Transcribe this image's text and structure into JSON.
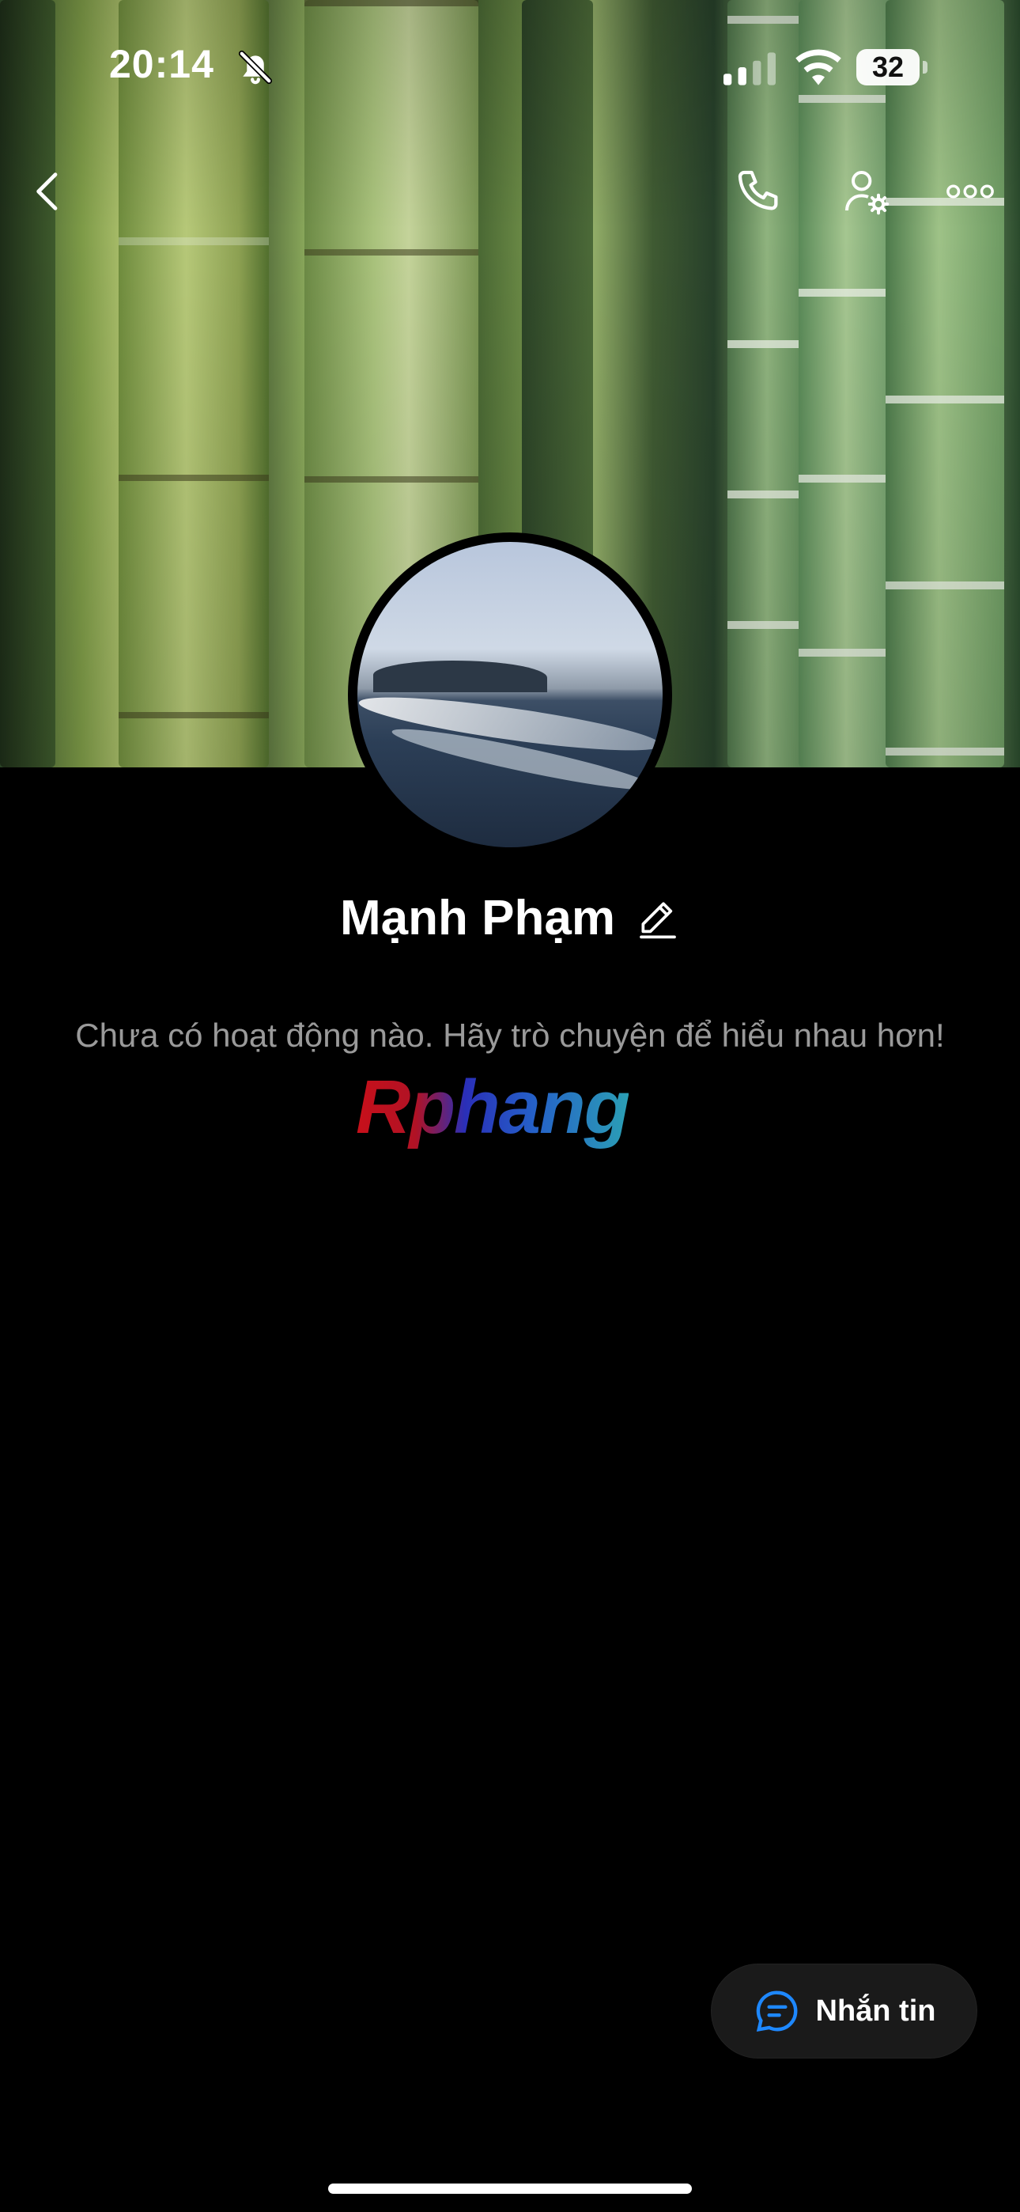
{
  "status_bar": {
    "time": "20:14",
    "battery_level": "32",
    "icons": [
      "bell-slash-icon",
      "cellular-signal-icon",
      "wifi-icon",
      "battery-icon"
    ]
  },
  "nav": {
    "icons": [
      "chevron-left-icon",
      "phone-icon",
      "user-settings-icon",
      "more-icon"
    ]
  },
  "profile": {
    "name": "Mạnh Phạm",
    "empty_message": "Chưa có hoạt động nào. Hãy trò chuyện để hiểu nhau hơn!"
  },
  "watermark": "Rphang",
  "message_button": {
    "label": "Nhắn tin",
    "icon": "chat-bubble-icon",
    "accent": "#1e88ff"
  }
}
